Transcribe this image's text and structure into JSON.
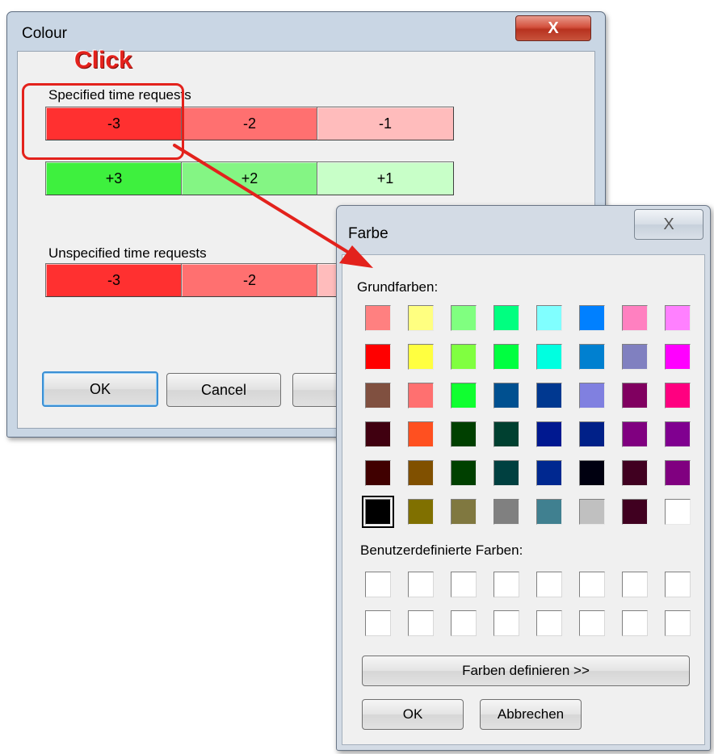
{
  "colour_dialog": {
    "title": "Colour",
    "close_label": "X",
    "specified_label": "Specified time requests",
    "unspecified_label": "Unspecified time requests",
    "specified_buttons": [
      {
        "label": "-3",
        "color": "#ff3030"
      },
      {
        "label": "-2",
        "color": "#ff7070"
      },
      {
        "label": "-1",
        "color": "#ffbcbc"
      },
      {
        "label": "+3",
        "color": "#3ef03e"
      },
      {
        "label": "+2",
        "color": "#84f584"
      },
      {
        "label": "+1",
        "color": "#c8ffc8"
      }
    ],
    "unspecified_buttons": [
      {
        "label": "-3",
        "color": "#ff3030"
      },
      {
        "label": "-2",
        "color": "#ff7070"
      },
      {
        "label": "",
        "color": "#ffbcbc"
      }
    ],
    "ok_label": "OK",
    "cancel_label": "Cancel"
  },
  "annotation": {
    "text": "Click",
    "color": "#e3221c"
  },
  "farbe_dialog": {
    "title": "Farbe",
    "close_label": "X",
    "basic_label": "Grundfarben:",
    "basic_colors": [
      [
        "#ff8080",
        "#ffff80",
        "#80ff80",
        "#00ff80",
        "#80ffff",
        "#0080ff",
        "#ff80c0",
        "#ff80ff"
      ],
      [
        "#ff0000",
        "#ffff40",
        "#80ff40",
        "#00ff40",
        "#00ffe0",
        "#0080d0",
        "#8080c0",
        "#ff00ff"
      ],
      [
        "#805040",
        "#ff7070",
        "#10ff30",
        "#005090",
        "#003890",
        "#8080e0",
        "#800060",
        "#ff0080"
      ],
      [
        "#400010",
        "#ff5020",
        "#004000",
        "#004030",
        "#001890",
        "#002088",
        "#800080",
        "#800090"
      ],
      [
        "#400000",
        "#805000",
        "#004000",
        "#004040",
        "#002890",
        "#000010",
        "#400020",
        "#800080"
      ],
      [
        "#000000",
        "#807000",
        "#807840",
        "#808080",
        "#408090",
        "#c0c0c0",
        "#400020",
        "#ffffff"
      ]
    ],
    "selected_basic": "0,5",
    "custom_label": "Benutzerdefinierte Farben:",
    "define_label": "Farben definieren >>",
    "ok_label": "OK",
    "cancel_label": "Abbrechen"
  }
}
